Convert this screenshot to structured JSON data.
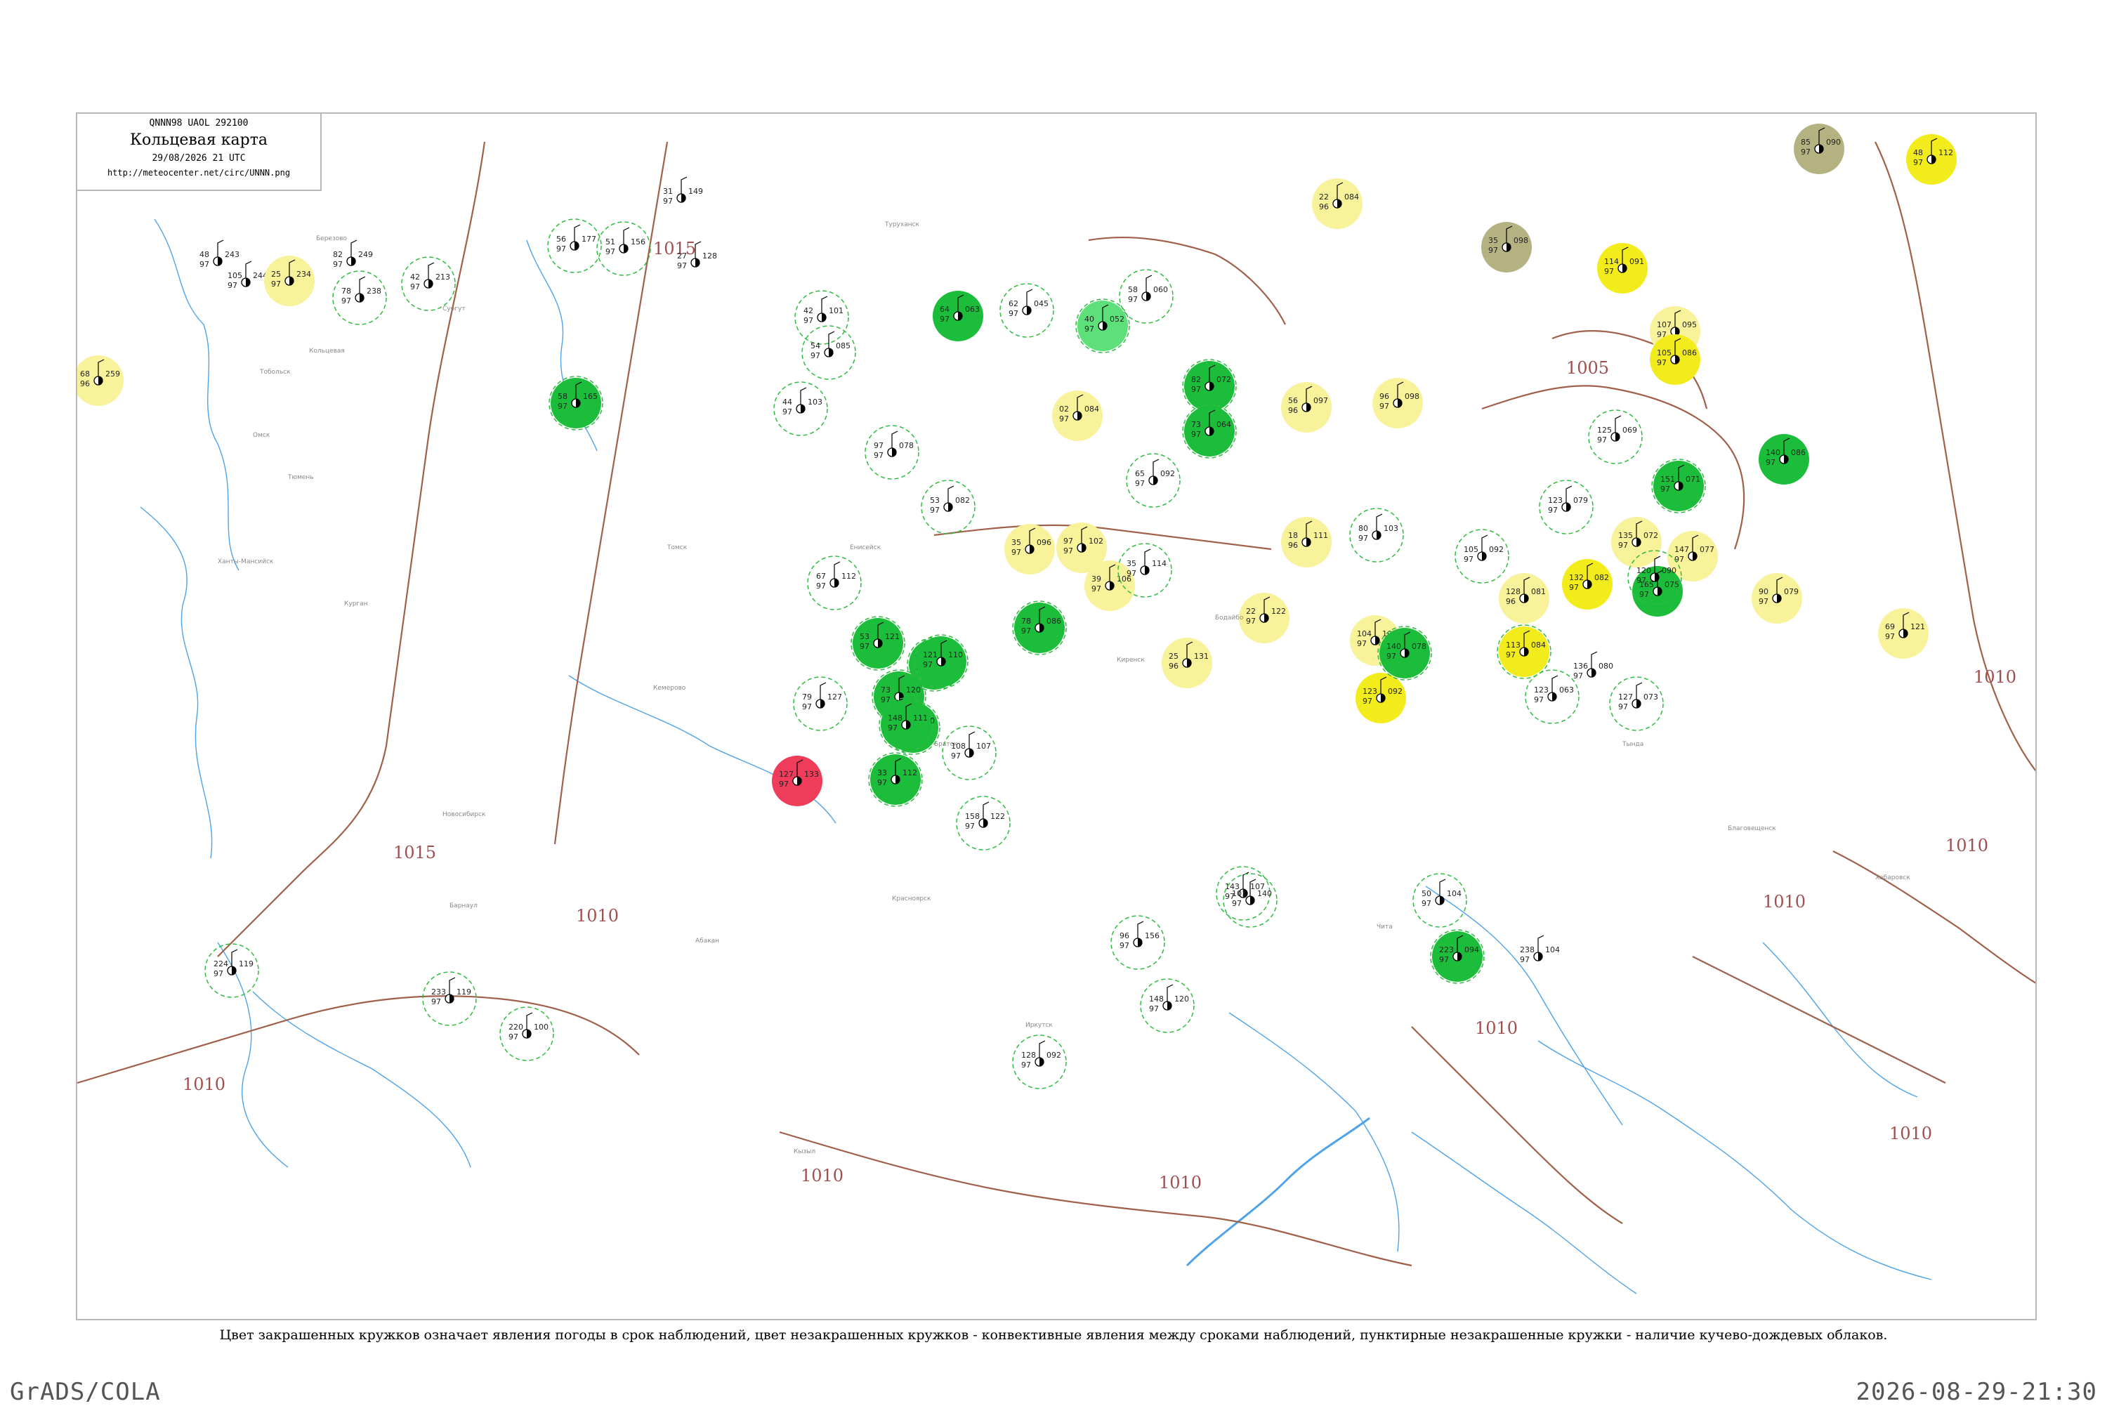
{
  "header": {
    "code": "QNNN98  UAOL  292100",
    "title": "Кольцевая карта",
    "datetime": "29/08/2026 21 UTC",
    "url": "http://meteocenter.net/circ/UNNN.png"
  },
  "caption": "Цвет закрашенных кружков означает явления погоды в срок наблюдений, цвет незакрашенных кружков - конвективные явления между сроками наблюдений, пунктирные незакрашенные кружки - наличие кучево-дождевых облаков.",
  "footer": {
    "left": "GrADS/COLA",
    "right": "2026-08-29-21:30"
  },
  "colors": {
    "isobar": "#a0604a",
    "river": "#4fa3e8",
    "green_fill": "#1bbd3a",
    "light_green_fill": "#5de07a",
    "yellow_fill": "#f3ec1c",
    "pale_yellow_fill": "#f8f29a",
    "olive_fill": "#b5b282",
    "red_fill": "#ef3c5a",
    "dashed_ring": "#33bb44"
  },
  "isobar_labels": [
    "1015",
    "1015",
    "1010",
    "1010",
    "1010",
    "1010",
    "1010",
    "1010",
    "1010",
    "1010",
    "1010",
    "1005"
  ],
  "stations": [
    {
      "t": "82",
      "td": "97",
      "p": "249",
      "fill": "none",
      "ring": false
    },
    {
      "t": "48",
      "td": "97",
      "p": "243",
      "fill": "none",
      "ring": false
    },
    {
      "t": "105",
      "td": "97",
      "p": "244",
      "fill": "none",
      "ring": false
    },
    {
      "t": "25",
      "td": "97",
      "p": "234",
      "fill": "pale",
      "ring": false
    },
    {
      "t": "68",
      "td": "96",
      "p": "259",
      "fill": "pale",
      "ring": false
    },
    {
      "t": "78",
      "td": "97",
      "p": "238",
      "fill": "none",
      "ring": true
    },
    {
      "t": "42",
      "td": "97",
      "p": "213",
      "fill": "none",
      "ring": true
    },
    {
      "t": "56",
      "td": "97",
      "p": "177",
      "fill": "none",
      "ring": true
    },
    {
      "t": "51",
      "td": "97",
      "p": "156",
      "fill": "none",
      "ring": true
    },
    {
      "t": "58",
      "td": "97",
      "p": "165",
      "fill": "green",
      "ring": true
    },
    {
      "t": "31",
      "td": "97",
      "p": "149",
      "fill": "none",
      "ring": false
    },
    {
      "t": "27",
      "td": "97",
      "p": "128",
      "fill": "none",
      "ring": false
    },
    {
      "t": "42",
      "td": "97",
      "p": "101",
      "fill": "none",
      "ring": true
    },
    {
      "t": "54",
      "td": "97",
      "p": "085",
      "fill": "none",
      "ring": true
    },
    {
      "t": "44",
      "td": "97",
      "p": "103",
      "fill": "none",
      "ring": true
    },
    {
      "t": "64",
      "td": "97",
      "p": "063",
      "fill": "green",
      "ring": false
    },
    {
      "t": "62",
      "td": "97",
      "p": "045",
      "fill": "none",
      "ring": true
    },
    {
      "t": "40",
      "td": "97",
      "p": "052",
      "fill": "lightgreen",
      "ring": true
    },
    {
      "t": "58",
      "td": "97",
      "p": "060",
      "fill": "none",
      "ring": true
    },
    {
      "t": "82",
      "td": "97",
      "p": "072",
      "fill": "green",
      "ring": true
    },
    {
      "t": "73",
      "td": "97",
      "p": "064",
      "fill": "green",
      "ring": true
    },
    {
      "t": "02",
      "td": "97",
      "p": "084",
      "fill": "pale",
      "ring": false
    },
    {
      "t": "97",
      "td": "97",
      "p": "078",
      "fill": "none",
      "ring": true
    },
    {
      "t": "65",
      "td": "97",
      "p": "092",
      "fill": "none",
      "ring": true
    },
    {
      "t": "22",
      "td": "96",
      "p": "084",
      "fill": "pale",
      "ring": false
    },
    {
      "t": "56",
      "td": "96",
      "p": "097",
      "fill": "pale",
      "ring": false
    },
    {
      "t": "96",
      "td": "97",
      "p": "098",
      "fill": "pale",
      "ring": false
    },
    {
      "t": "35",
      "td": "97",
      "p": "098",
      "fill": "olive",
      "ring": false
    },
    {
      "t": "85",
      "td": "97",
      "p": "090",
      "fill": "olive",
      "ring": false
    },
    {
      "t": "48",
      "td": "97",
      "p": "112",
      "fill": "yellow",
      "ring": false
    },
    {
      "t": "114",
      "td": "97",
      "p": "091",
      "fill": "yellow",
      "ring": false
    },
    {
      "t": "107",
      "td": "97",
      "p": "095",
      "fill": "pale",
      "ring": false
    },
    {
      "t": "105",
      "td": "97",
      "p": "086",
      "fill": "yellow",
      "ring": false
    },
    {
      "t": "125",
      "td": "97",
      "p": "069",
      "fill": "none",
      "ring": true
    },
    {
      "t": "140",
      "td": "97",
      "p": "086",
      "fill": "green",
      "ring": false
    },
    {
      "t": "151",
      "td": "97",
      "p": "071",
      "fill": "green",
      "ring": true
    },
    {
      "t": "123",
      "td": "97",
      "p": "079",
      "fill": "none",
      "ring": true
    },
    {
      "t": "135",
      "td": "97",
      "p": "072",
      "fill": "pale",
      "ring": false
    },
    {
      "t": "147",
      "td": "97",
      "p": "077",
      "fill": "pale",
      "ring": false
    },
    {
      "t": "132",
      "td": "97",
      "p": "082",
      "fill": "yellow",
      "ring": false
    },
    {
      "t": "128",
      "td": "96",
      "p": "081",
      "fill": "pale",
      "ring": false
    },
    {
      "t": "105",
      "td": "97",
      "p": "092",
      "fill": "none",
      "ring": true
    },
    {
      "t": "165",
      "td": "97",
      "p": "075",
      "fill": "green",
      "ring": false
    },
    {
      "t": "120",
      "td": "97",
      "p": "090",
      "fill": "none",
      "ring": true
    },
    {
      "t": "90",
      "td": "97",
      "p": "079",
      "fill": "pale",
      "ring": false
    },
    {
      "t": "69",
      "td": "97",
      "p": "121",
      "fill": "pale",
      "ring": false
    },
    {
      "t": "113",
      "td": "97",
      "p": "084",
      "fill": "yellow",
      "ring": true
    },
    {
      "t": "136",
      "td": "97",
      "p": "080",
      "fill": "none",
      "ring": false
    },
    {
      "t": "123",
      "td": "97",
      "p": "063",
      "fill": "none",
      "ring": true
    },
    {
      "t": "127",
      "td": "97",
      "p": "073",
      "fill": "none",
      "ring": true
    },
    {
      "t": "18",
      "td": "96",
      "p": "111",
      "fill": "pale",
      "ring": false
    },
    {
      "t": "104",
      "td": "97",
      "p": "108",
      "fill": "pale",
      "ring": false
    },
    {
      "t": "123",
      "td": "97",
      "p": "092",
      "fill": "yellow",
      "ring": false
    },
    {
      "t": "140",
      "td": "97",
      "p": "078",
      "fill": "green",
      "ring": true
    },
    {
      "t": "35",
      "td": "97",
      "p": "096",
      "fill": "pale",
      "ring": false
    },
    {
      "t": "97",
      "td": "97",
      "p": "102",
      "fill": "pale",
      "ring": false
    },
    {
      "t": "39",
      "td": "97",
      "p": "106",
      "fill": "pale",
      "ring": false
    },
    {
      "t": "22",
      "td": "97",
      "p": "122",
      "fill": "pale",
      "ring": false
    },
    {
      "t": "25",
      "td": "96",
      "p": "131",
      "fill": "pale",
      "ring": false
    },
    {
      "t": "35",
      "td": "97",
      "p": "114",
      "fill": "none",
      "ring": true
    },
    {
      "t": "80",
      "td": "97",
      "p": "103",
      "fill": "none",
      "ring": true
    },
    {
      "t": "53",
      "td": "97",
      "p": "082",
      "fill": "none",
      "ring": true
    },
    {
      "t": "78",
      "td": "97",
      "p": "086",
      "fill": "green",
      "ring": true
    },
    {
      "t": "53",
      "td": "97",
      "p": "121",
      "fill": "green",
      "ring": true
    },
    {
      "t": "66",
      "td": "97",
      "p": "123",
      "fill": "green",
      "ring": true
    },
    {
      "t": "73",
      "td": "97",
      "p": "120",
      "fill": "green",
      "ring": true
    },
    {
      "t": "107",
      "td": "97",
      "p": "110",
      "fill": "green",
      "ring": true
    },
    {
      "t": "67",
      "td": "97",
      "p": "112",
      "fill": "none",
      "ring": true
    },
    {
      "t": "79",
      "td": "97",
      "p": "127",
      "fill": "none",
      "ring": true
    },
    {
      "t": "127",
      "td": "97",
      "p": "133",
      "fill": "red",
      "ring": false
    },
    {
      "t": "33",
      "td": "97",
      "p": "112",
      "fill": "green",
      "ring": true
    },
    {
      "t": "148",
      "td": "97",
      "p": "111",
      "fill": "green",
      "ring": true
    },
    {
      "t": "121",
      "td": "97",
      "p": "110",
      "fill": "green",
      "ring": true
    },
    {
      "t": "108",
      "td": "97",
      "p": "107",
      "fill": "none",
      "ring": true
    },
    {
      "t": "158",
      "td": "97",
      "p": "122",
      "fill": "none",
      "ring": true
    },
    {
      "t": "143",
      "td": "97",
      "p": "107",
      "fill": "none",
      "ring": true
    },
    {
      "t": "96",
      "td": "97",
      "p": "156",
      "fill": "none",
      "ring": true
    },
    {
      "t": "148",
      "td": "97",
      "p": "120",
      "fill": "none",
      "ring": true
    },
    {
      "t": "128",
      "td": "97",
      "p": "092",
      "fill": "none",
      "ring": true
    },
    {
      "t": "101",
      "td": "97",
      "p": "140",
      "fill": "none",
      "ring": true
    },
    {
      "t": "50",
      "td": "97",
      "p": "104",
      "fill": "none",
      "ring": true
    },
    {
      "t": "223",
      "td": "97",
      "p": "094",
      "fill": "green",
      "ring": true
    },
    {
      "t": "238",
      "td": "97",
      "p": "104",
      "fill": "none",
      "ring": false
    },
    {
      "t": "233",
      "td": "97",
      "p": "119",
      "fill": "none",
      "ring": true
    },
    {
      "t": "220",
      "td": "97",
      "p": "100",
      "fill": "none",
      "ring": true
    },
    {
      "t": "224",
      "td": "97",
      "p": "119",
      "fill": "none",
      "ring": true
    }
  ],
  "sample_labels": [
    "Кольцевая",
    "Березово",
    "Сургут",
    "Тюмень",
    "Курган",
    "Омск",
    "Томск",
    "Кемерово",
    "Новосибирск",
    "Барнаул",
    "Ханты-Мансийск",
    "Тобольск",
    "Туруханск",
    "Енисейск",
    "Красноярск",
    "Абакан",
    "Кызыл",
    "Иркутск",
    "Братск",
    "Киренск",
    "Бодайбо",
    "Чита",
    "Тында",
    "Благовещенск",
    "Хабаровск"
  ]
}
